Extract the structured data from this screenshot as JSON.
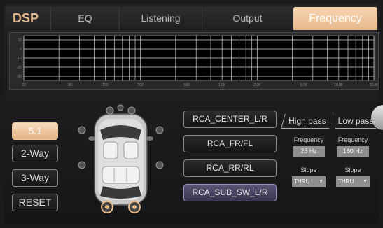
{
  "tabs": {
    "dsp": "DSP",
    "eq": "EQ",
    "listening": "Listening",
    "output": "Output",
    "frequency": "Frequency"
  },
  "graph": {
    "y_ticks": [
      "10",
      "0",
      "-10",
      "-20",
      "-30"
    ],
    "x_ticks": [
      "20",
      "50",
      "100",
      "200",
      "500",
      "1.0K",
      "2.0K",
      "5.0K",
      "10.0K",
      "20.0K"
    ]
  },
  "modes": {
    "five_one": "5.1",
    "two_way": "2-Way",
    "three_way": "3-Way",
    "reset": "RESET",
    "selected": "5.1"
  },
  "channels": {
    "center": "RCA_CENTER_L/R",
    "front": "RCA_FR/FL",
    "rear": "RCA_RR/RL",
    "sub": "RCA_SUB_SW_L/R",
    "selected": "RCA_SUB_SW_L/R"
  },
  "filters": {
    "high_pass": {
      "label": "High pass",
      "frequency_label": "Frequency",
      "frequency": "25 Hz",
      "slope_label": "Slope",
      "slope": "THRU"
    },
    "low_pass": {
      "label": "Low pass",
      "frequency_label": "Frequency",
      "frequency": "160 Hz",
      "slope_label": "Slope",
      "slope": "THRU"
    }
  },
  "colors": {
    "accent": "#e8b98c",
    "selected_channel": "#4a4462"
  }
}
